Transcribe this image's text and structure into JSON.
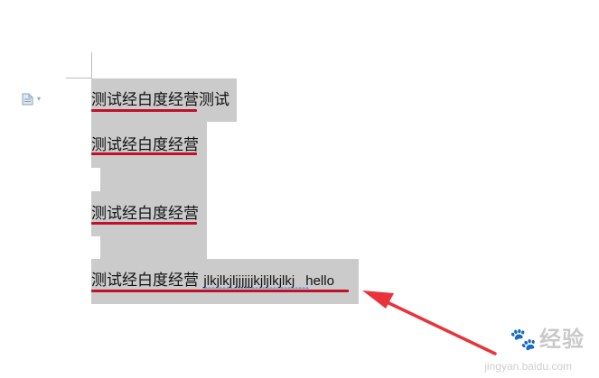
{
  "document": {
    "lines": [
      {
        "cjk": "测试经白度经营",
        "tail": "测试"
      },
      {
        "cjk": "测试经白度经营",
        "tail": ""
      },
      {
        "cjk": "测试经白度经营",
        "tail": ""
      },
      {
        "cjk": "测试经白度经营",
        "latin": "jlkjlkjljjjjjjkjljlkjlkj",
        "hello": "hello"
      }
    ]
  },
  "icons": {
    "left_margin": "document-paste-icon",
    "caret": "▾"
  },
  "watermark": {
    "brand": "经验",
    "url": "jingyan.baidu.com"
  },
  "colors": {
    "selection": "#cbcbcb",
    "underline": "#c0102a",
    "arrow": "#e8333a"
  }
}
